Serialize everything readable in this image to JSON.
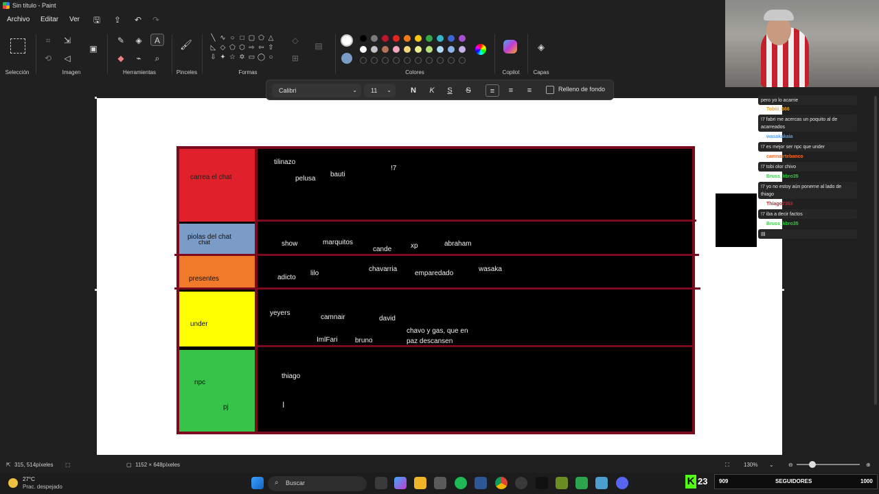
{
  "window": {
    "title": "Sin título - Paint"
  },
  "menu": {
    "file": "Archivo",
    "edit": "Editar",
    "view": "Ver"
  },
  "ribbon": {
    "selection": "Selección",
    "image": "Imagen",
    "tools": "Herramientas",
    "brushes": "Pinceles",
    "shapes": "Formas",
    "colors": "Colores",
    "copilot": "Copilot",
    "layers": "Capas"
  },
  "textbar": {
    "font": "Calibri",
    "size": "11",
    "bold": "N",
    "italic": "K",
    "underline": "S",
    "strike": "S",
    "fill_label": "Relleno de fondo"
  },
  "colors": {
    "row1": [
      "#000000",
      "#7a7a7a",
      "#c0152b",
      "#e02424",
      "#f07a1a",
      "#f5c518",
      "#32a84a",
      "#33b5c9",
      "#3b66d6",
      "#a64fd0"
    ],
    "row2": [
      "#ffffff",
      "#c3c3c3",
      "#b5735a",
      "#f3a6c0",
      "#f5d57a",
      "#e8ef8a",
      "#b6e07a",
      "#a9dcef",
      "#8fb3ea",
      "#c5b0e8"
    ]
  },
  "tiers": [
    {
      "label": "carrea el chat",
      "color": "#e0202b"
    },
    {
      "label": "piolas del chat",
      "sub": "chat",
      "color": "#7a9cc6"
    },
    {
      "label": "presentes",
      "color": "#f07a2a"
    },
    {
      "label": "under",
      "color": "#ffff00"
    },
    {
      "label": "npc",
      "sub": "pj",
      "color": "#37c24a"
    }
  ],
  "names": {
    "tier1": [
      "tilinazo",
      "pelusa",
      "bauti",
      "!7"
    ],
    "tier2": [
      "show",
      "marquitos",
      "cande",
      "xp",
      "abraham"
    ],
    "tier3": [
      "adicto",
      "lilo",
      "chavarria",
      "emparedado",
      "wasaka"
    ],
    "tier4": [
      "yeyers",
      "camnair",
      "david",
      "ImlFari",
      "bruno",
      "chavo y gas, que en",
      "paz descansen"
    ],
    "tier5": [
      "thiago"
    ]
  },
  "chat": [
    {
      "user": "",
      "text": "pero yo lo acarrie"
    },
    {
      "user": "Tobiii_666",
      "color": "#f0a020",
      "text": "!7 fabri me acercas un poquito al de acarreados"
    },
    {
      "user": "wasakakaia",
      "color": "#5aa0f0",
      "text": "!7 es mejor ser npc que under"
    },
    {
      "user": "camnairtebanco",
      "color": "#f06a20",
      "text": "!7 tobi olor chivo"
    },
    {
      "user": "Bruss_kbro35",
      "color": "#30d040",
      "text": "!7 yo no estoy aún ponerne al lado de thiago"
    },
    {
      "user": "Thiago7363",
      "color": "#d0202b",
      "text": "!7 iba a decir factos"
    },
    {
      "user": "Bruss_kbro35",
      "color": "#30d040",
      "text": ""
    }
  ],
  "status": {
    "cursor": "315, 514píxeles",
    "canvas_size": "1152 × 648píxeles",
    "zoom": "130%"
  },
  "taskbar": {
    "weather_temp": "27°C",
    "weather_desc": "Prac. despejado",
    "search": "Buscar"
  },
  "kick": {
    "count": "23"
  },
  "followers": {
    "current": "909",
    "label": "SEGUIDORES",
    "goal": "1000"
  }
}
